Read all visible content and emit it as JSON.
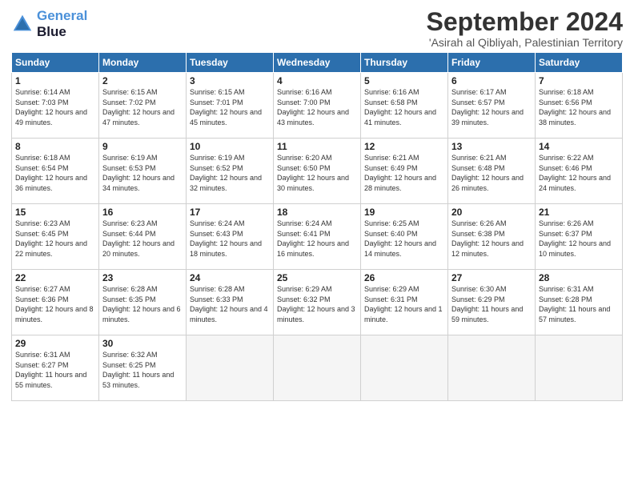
{
  "header": {
    "logo_line1": "General",
    "logo_line2": "Blue",
    "month": "September 2024",
    "location": "'Asirah al Qibliyah, Palestinian Territory"
  },
  "days_of_week": [
    "Sunday",
    "Monday",
    "Tuesday",
    "Wednesday",
    "Thursday",
    "Friday",
    "Saturday"
  ],
  "weeks": [
    [
      {
        "num": "1",
        "sunrise": "6:14 AM",
        "sunset": "7:03 PM",
        "daylight": "12 hours and 49 minutes."
      },
      {
        "num": "2",
        "sunrise": "6:15 AM",
        "sunset": "7:02 PM",
        "daylight": "12 hours and 47 minutes."
      },
      {
        "num": "3",
        "sunrise": "6:15 AM",
        "sunset": "7:01 PM",
        "daylight": "12 hours and 45 minutes."
      },
      {
        "num": "4",
        "sunrise": "6:16 AM",
        "sunset": "7:00 PM",
        "daylight": "12 hours and 43 minutes."
      },
      {
        "num": "5",
        "sunrise": "6:16 AM",
        "sunset": "6:58 PM",
        "daylight": "12 hours and 41 minutes."
      },
      {
        "num": "6",
        "sunrise": "6:17 AM",
        "sunset": "6:57 PM",
        "daylight": "12 hours and 39 minutes."
      },
      {
        "num": "7",
        "sunrise": "6:18 AM",
        "sunset": "6:56 PM",
        "daylight": "12 hours and 38 minutes."
      }
    ],
    [
      {
        "num": "8",
        "sunrise": "6:18 AM",
        "sunset": "6:54 PM",
        "daylight": "12 hours and 36 minutes."
      },
      {
        "num": "9",
        "sunrise": "6:19 AM",
        "sunset": "6:53 PM",
        "daylight": "12 hours and 34 minutes."
      },
      {
        "num": "10",
        "sunrise": "6:19 AM",
        "sunset": "6:52 PM",
        "daylight": "12 hours and 32 minutes."
      },
      {
        "num": "11",
        "sunrise": "6:20 AM",
        "sunset": "6:50 PM",
        "daylight": "12 hours and 30 minutes."
      },
      {
        "num": "12",
        "sunrise": "6:21 AM",
        "sunset": "6:49 PM",
        "daylight": "12 hours and 28 minutes."
      },
      {
        "num": "13",
        "sunrise": "6:21 AM",
        "sunset": "6:48 PM",
        "daylight": "12 hours and 26 minutes."
      },
      {
        "num": "14",
        "sunrise": "6:22 AM",
        "sunset": "6:46 PM",
        "daylight": "12 hours and 24 minutes."
      }
    ],
    [
      {
        "num": "15",
        "sunrise": "6:23 AM",
        "sunset": "6:45 PM",
        "daylight": "12 hours and 22 minutes."
      },
      {
        "num": "16",
        "sunrise": "6:23 AM",
        "sunset": "6:44 PM",
        "daylight": "12 hours and 20 minutes."
      },
      {
        "num": "17",
        "sunrise": "6:24 AM",
        "sunset": "6:43 PM",
        "daylight": "12 hours and 18 minutes."
      },
      {
        "num": "18",
        "sunrise": "6:24 AM",
        "sunset": "6:41 PM",
        "daylight": "12 hours and 16 minutes."
      },
      {
        "num": "19",
        "sunrise": "6:25 AM",
        "sunset": "6:40 PM",
        "daylight": "12 hours and 14 minutes."
      },
      {
        "num": "20",
        "sunrise": "6:26 AM",
        "sunset": "6:38 PM",
        "daylight": "12 hours and 12 minutes."
      },
      {
        "num": "21",
        "sunrise": "6:26 AM",
        "sunset": "6:37 PM",
        "daylight": "12 hours and 10 minutes."
      }
    ],
    [
      {
        "num": "22",
        "sunrise": "6:27 AM",
        "sunset": "6:36 PM",
        "daylight": "12 hours and 8 minutes."
      },
      {
        "num": "23",
        "sunrise": "6:28 AM",
        "sunset": "6:35 PM",
        "daylight": "12 hours and 6 minutes."
      },
      {
        "num": "24",
        "sunrise": "6:28 AM",
        "sunset": "6:33 PM",
        "daylight": "12 hours and 4 minutes."
      },
      {
        "num": "25",
        "sunrise": "6:29 AM",
        "sunset": "6:32 PM",
        "daylight": "12 hours and 3 minutes."
      },
      {
        "num": "26",
        "sunrise": "6:29 AM",
        "sunset": "6:31 PM",
        "daylight": "12 hours and 1 minute."
      },
      {
        "num": "27",
        "sunrise": "6:30 AM",
        "sunset": "6:29 PM",
        "daylight": "11 hours and 59 minutes."
      },
      {
        "num": "28",
        "sunrise": "6:31 AM",
        "sunset": "6:28 PM",
        "daylight": "11 hours and 57 minutes."
      }
    ],
    [
      {
        "num": "29",
        "sunrise": "6:31 AM",
        "sunset": "6:27 PM",
        "daylight": "11 hours and 55 minutes."
      },
      {
        "num": "30",
        "sunrise": "6:32 AM",
        "sunset": "6:25 PM",
        "daylight": "11 hours and 53 minutes."
      },
      null,
      null,
      null,
      null,
      null
    ]
  ]
}
